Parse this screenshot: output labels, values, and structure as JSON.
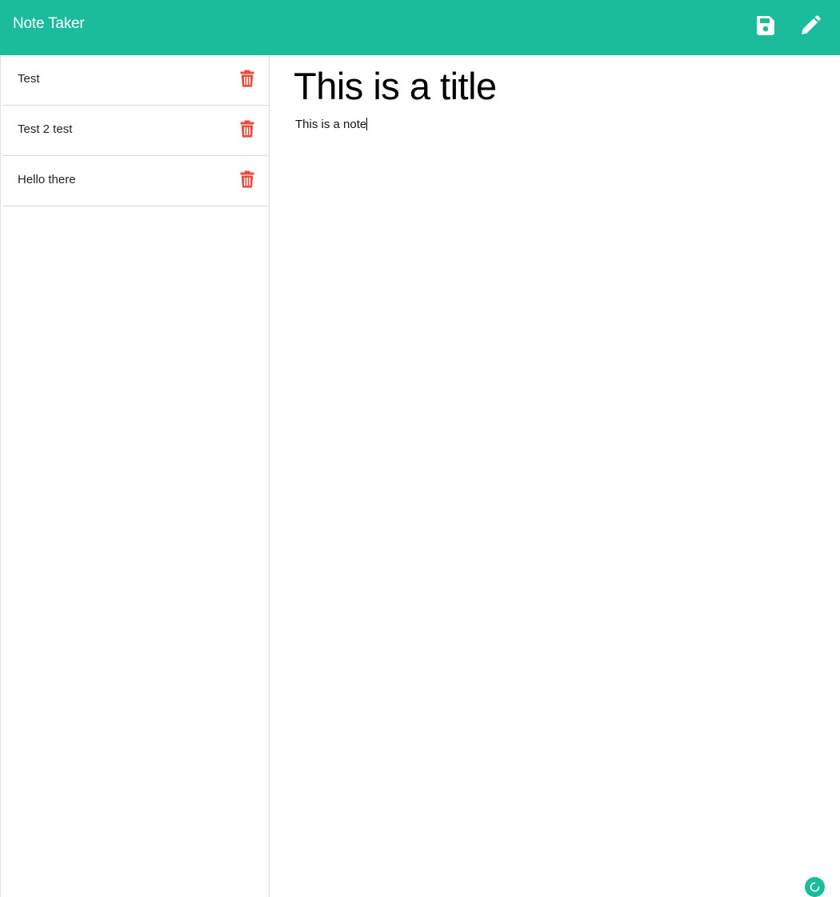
{
  "app": {
    "brand": "Note Taker",
    "accent_color": "#1abc9c",
    "delete_color": "#e74c3c"
  },
  "toolbar": {
    "save_icon": "floppy-disk-icon",
    "edit_icon": "pencil-icon"
  },
  "sidebar": {
    "notes": [
      {
        "title": "Test"
      },
      {
        "title": "Test 2 test"
      },
      {
        "title": "Hello there"
      }
    ],
    "delete_icon": "trash-icon"
  },
  "editor": {
    "title_value": "This is a title",
    "text_value": "This is a note"
  },
  "status": {
    "icon": "loading-spinner-icon"
  }
}
